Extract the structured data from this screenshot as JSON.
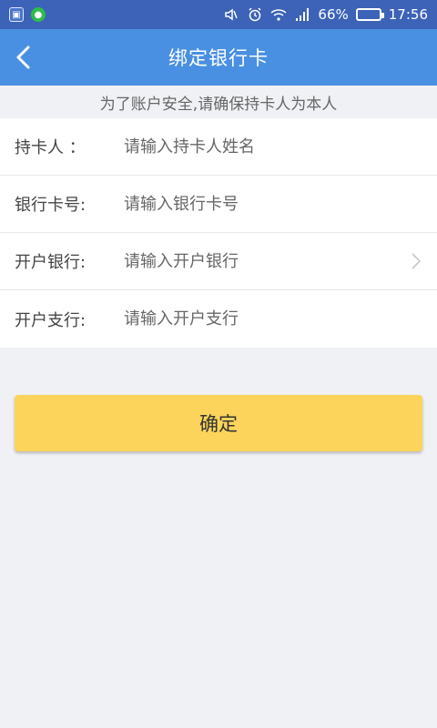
{
  "status_bar": {
    "battery_percent": "66%",
    "battery_level": 0.66,
    "time": "17:56",
    "icons": [
      "app-icon-1",
      "wechat-icon",
      "mute-icon",
      "alarm-icon",
      "wifi-icon",
      "signal-icon",
      "battery-icon"
    ]
  },
  "header": {
    "title": "绑定银行卡",
    "back_icon": "chevron-left-icon"
  },
  "notice": "为了账户安全,请确保持卡人为本人",
  "form": {
    "rows": [
      {
        "label": "持卡人 ：",
        "placeholder": "请输入持卡人姓名"
      },
      {
        "label": "银行卡号:",
        "placeholder": "请输入银行卡号"
      },
      {
        "label": "开户银行:",
        "placeholder": "请输入开户银行",
        "chevron_icon": "chevron-right-icon"
      },
      {
        "label": "开户支行:",
        "placeholder": "请输入开户支行"
      }
    ]
  },
  "confirm_label": "确定",
  "colors": {
    "status_bar": "#3c63b8",
    "header": "#4a90e2",
    "button": "#fcd45c",
    "background": "#f0f1f5"
  }
}
